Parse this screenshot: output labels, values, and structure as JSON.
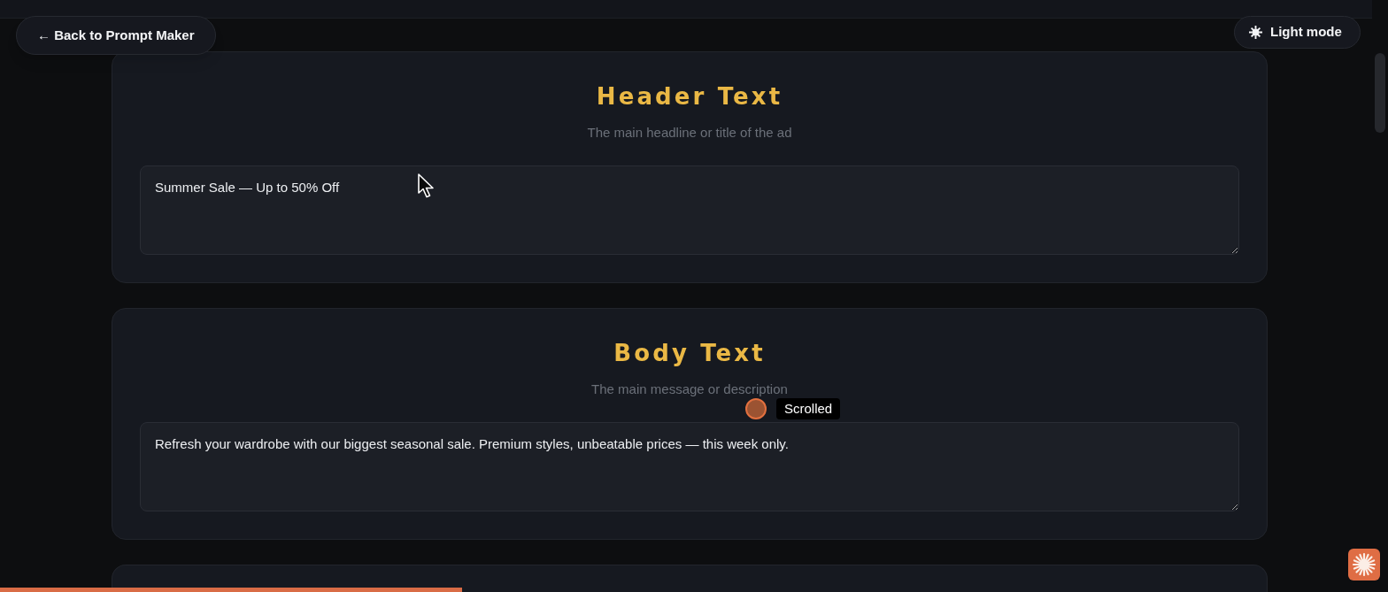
{
  "back_button": {
    "label": "← Back to Prompt Maker"
  },
  "theme_toggle": {
    "label": "Light mode"
  },
  "sections": [
    {
      "title": "Header Text",
      "description": "The main headline or title of the ad",
      "value": "Summer Sale — Up to 50% Off"
    },
    {
      "title": "Body Text",
      "description": "The main message or description",
      "value": "Refresh your wardrobe with our biggest seasonal sale. Premium styles, unbeatable prices — this week only."
    }
  ],
  "scroll_progress": {
    "level": 0.333
  },
  "overlay": {
    "label": "Scrolled"
  }
}
